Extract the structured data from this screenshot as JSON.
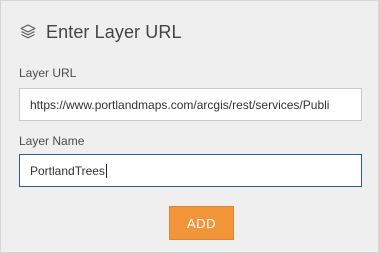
{
  "dialog": {
    "title": "Enter Layer URL",
    "icon": "layers-icon"
  },
  "form": {
    "url_label": "Layer URL",
    "url_value": "https://www.portlandmaps.com/arcgis/rest/services/Publi",
    "name_label": "Layer Name",
    "name_value": "PortlandTrees",
    "add_label": "ADD"
  },
  "colors": {
    "background": "#efefef",
    "accent": "#f29538",
    "focus_border": "#2c5d8f"
  }
}
